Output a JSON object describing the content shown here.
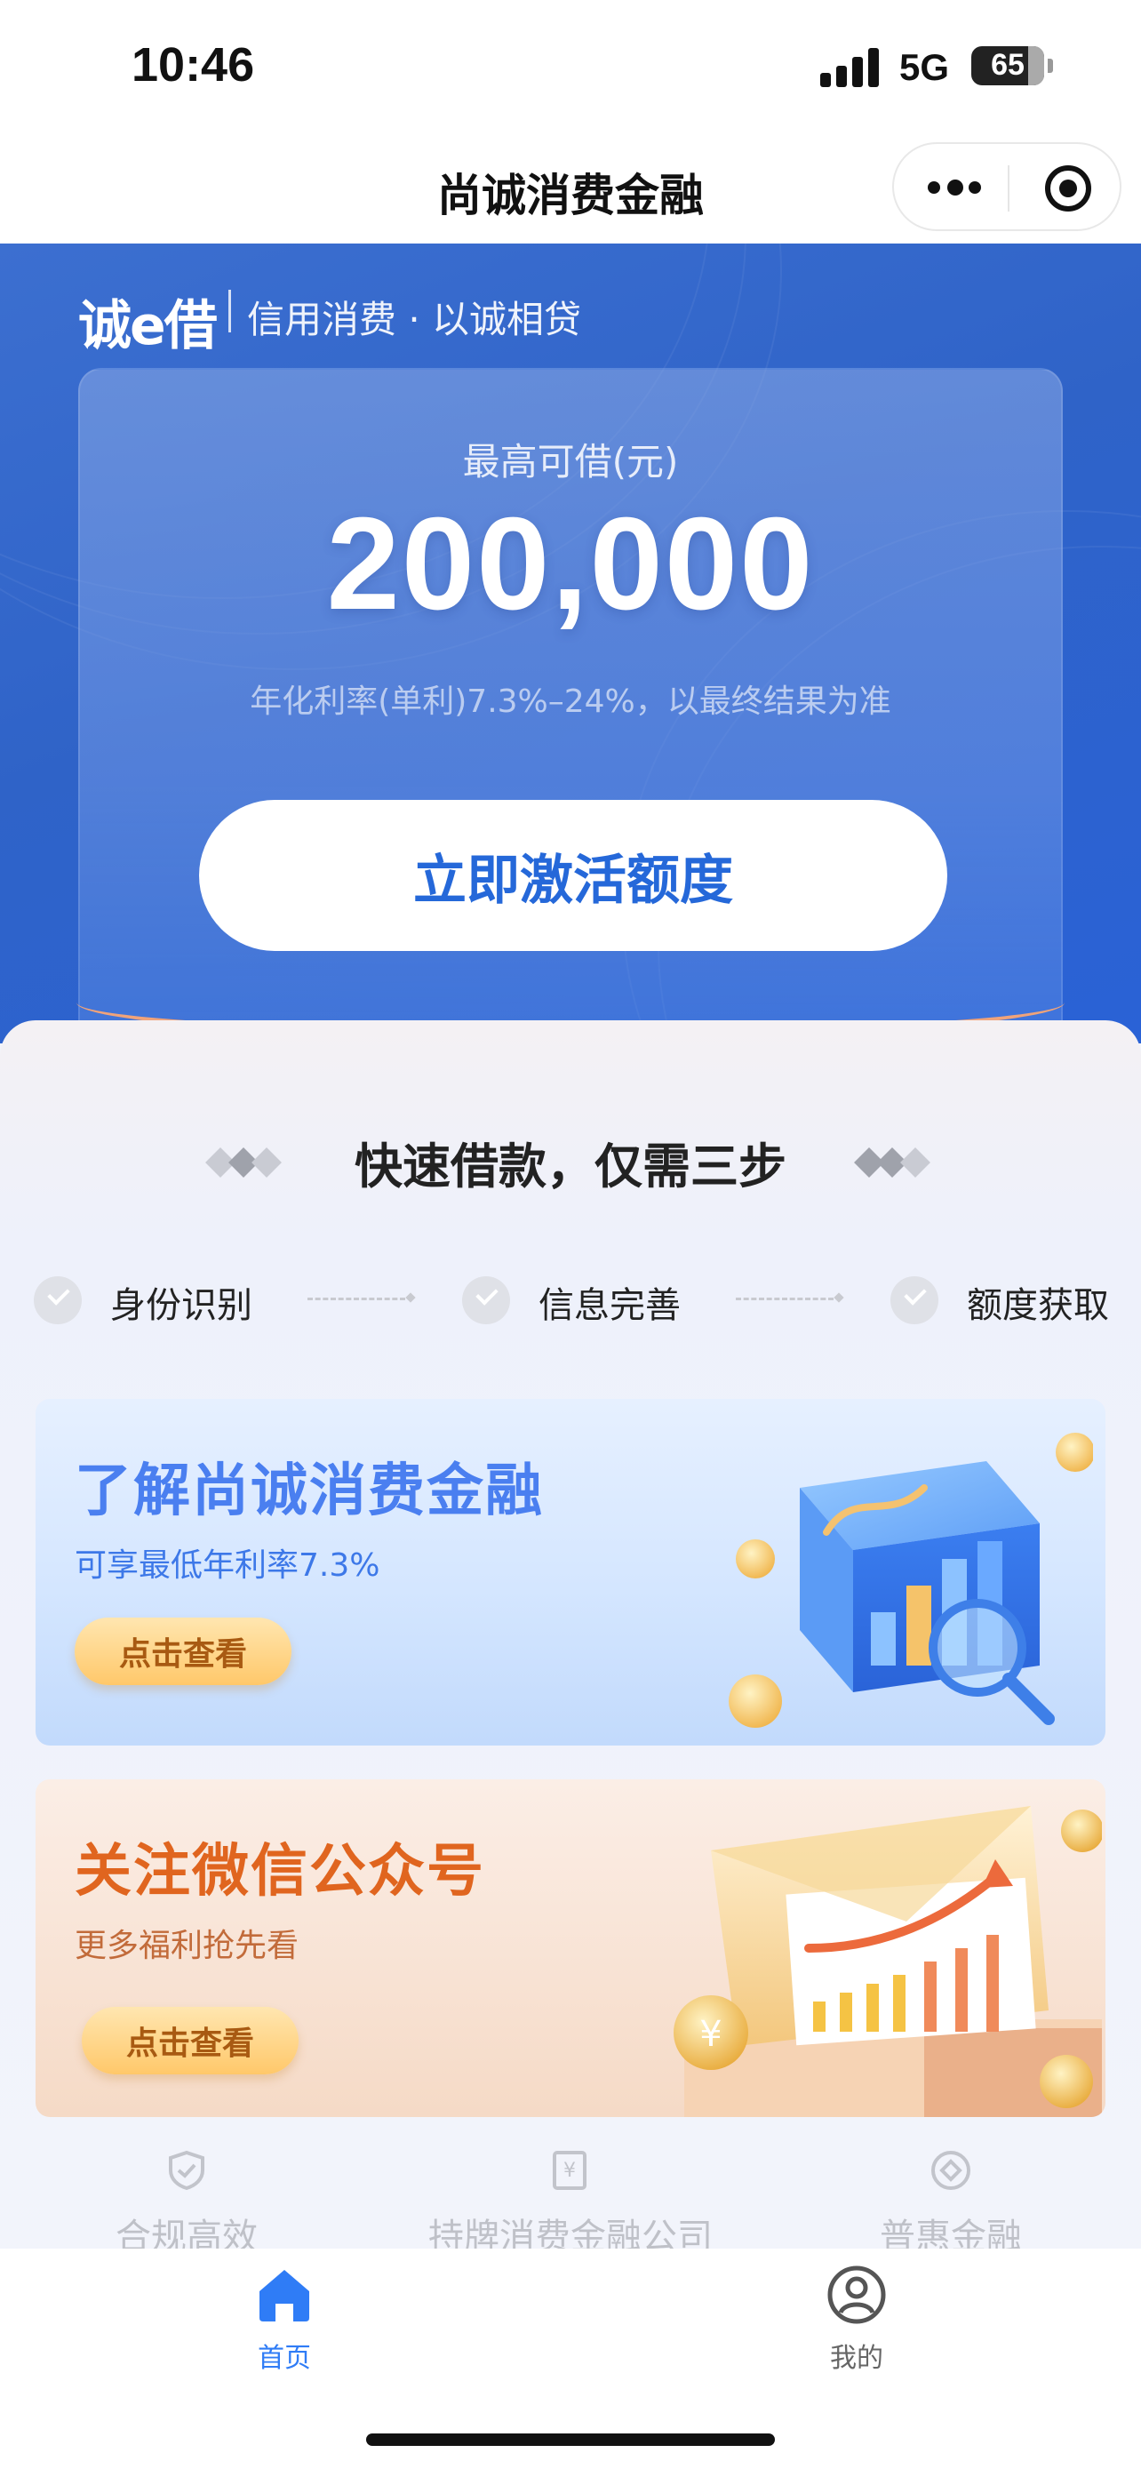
{
  "status_bar": {
    "time": "10:46",
    "network": "5G",
    "battery": "65"
  },
  "nav": {
    "title": "尚诚消费金融",
    "more_icon": "more-dots-icon",
    "close_icon": "target-circle-icon"
  },
  "hero": {
    "brand": "诚e借",
    "tagline": "信用消费 · 以诚相贷",
    "limit_label": "最高可借(元)",
    "limit_amount": "200,000",
    "rate_note": "年化利率(单利)7.3%–24%，以最终结果为准",
    "activate_label": "立即激活额度"
  },
  "steps": {
    "heading": "快速借款，仅需三步",
    "items": [
      {
        "label": "身份识别"
      },
      {
        "label": "信息完善"
      },
      {
        "label": "额度获取"
      }
    ]
  },
  "promos": [
    {
      "title": "了解尚诚消费金融",
      "subtitle": "可享最低年利率7.3%",
      "button": "点击查看",
      "accent": "#4a7ff0"
    },
    {
      "title": "关注微信公众号",
      "subtitle": "更多福利抢先看",
      "button": "点击查看",
      "accent": "#e0651f"
    }
  ],
  "features": [
    {
      "label": "合规高效",
      "icon": "shield-check-icon"
    },
    {
      "label": "持牌消费金融公司",
      "icon": "license-yuan-icon"
    },
    {
      "label": "普惠金融",
      "icon": "diamond-circle-icon"
    }
  ],
  "tabs": [
    {
      "label": "首页",
      "icon": "home-icon",
      "active": true,
      "color": "#2f7cf6"
    },
    {
      "label": "我的",
      "icon": "user-icon",
      "active": false,
      "color": "#666666"
    }
  ]
}
